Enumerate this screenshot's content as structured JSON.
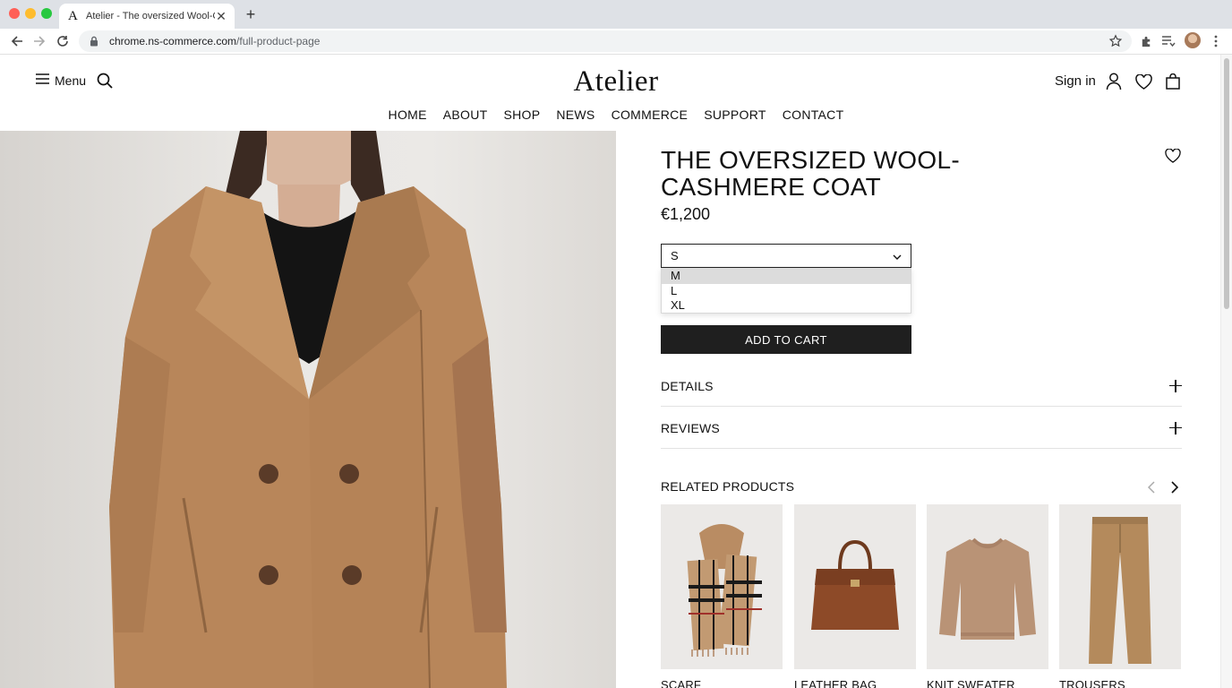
{
  "browser": {
    "tab_favicon": "A",
    "tab_title": "Atelier - The oversized Wool-C",
    "new_tab": "+",
    "url_domain": "chrome.ns-commerce.com",
    "url_path": "/full-product-page"
  },
  "header": {
    "menu_label": "Menu",
    "logo": "Atelier",
    "sign_in": "Sign in",
    "nav": [
      "HOME",
      "ABOUT",
      "SHOP",
      "NEWS",
      "COMMERCE",
      "SUPPORT",
      "CONTACT"
    ]
  },
  "product": {
    "title": "THE OVERSIZED WOOL-CASHMERE COAT",
    "price": "€1,200",
    "size_selected": "S",
    "size_options": [
      "M",
      "L",
      "XL"
    ],
    "size_highlighted": "M",
    "add_to_cart": "ADD TO CART",
    "details_label": "DETAILS",
    "reviews_label": "REVIEWS"
  },
  "related": {
    "title": "RELATED PRODUCTS",
    "items": [
      {
        "name": "SCARF"
      },
      {
        "name": "LEATHER BAG"
      },
      {
        "name": "KNIT SWEATER"
      },
      {
        "name": "TROUSERS"
      }
    ]
  },
  "colors": {
    "coat": "#b8865a",
    "button_dark": "#1f1f1f",
    "accent_text": "#111111"
  }
}
